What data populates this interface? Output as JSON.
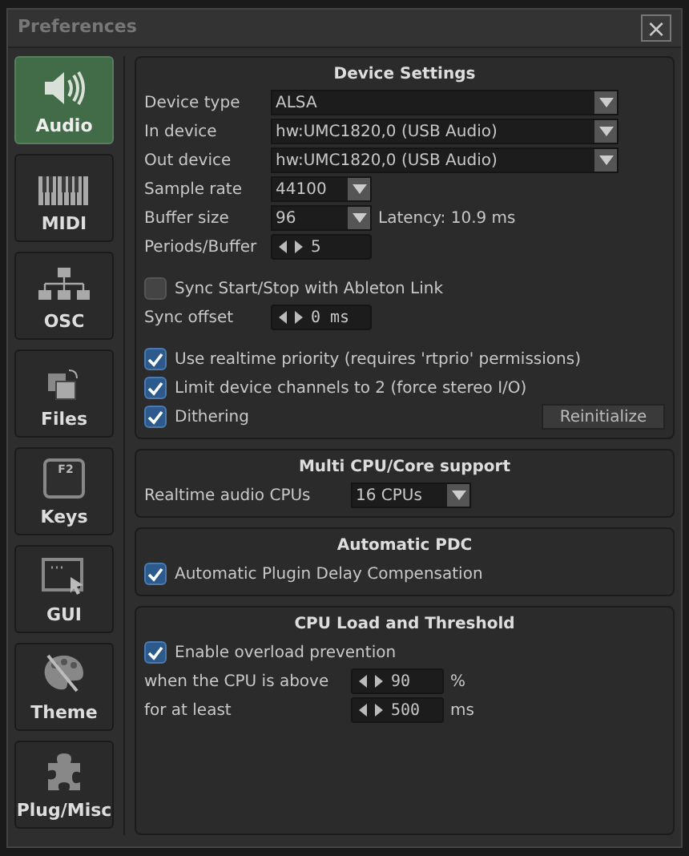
{
  "window": {
    "title": "Preferences",
    "close": "×"
  },
  "sidebar": {
    "items": [
      {
        "label": "Audio",
        "selected": true
      },
      {
        "label": "MIDI",
        "selected": false
      },
      {
        "label": "OSC",
        "selected": false
      },
      {
        "label": "Files",
        "selected": false
      },
      {
        "label": "Keys",
        "key_cap": "F2",
        "selected": false
      },
      {
        "label": "GUI",
        "selected": false
      },
      {
        "label": "Theme",
        "selected": false
      },
      {
        "label": "Plug/Misc",
        "selected": false
      }
    ]
  },
  "sections": [
    {
      "title": "Device Settings",
      "rows": [
        {
          "kind": "wide_select",
          "label": "Device type",
          "value": "ALSA"
        },
        {
          "kind": "wide_select",
          "label": "In device",
          "value": "hw:UMC1820,0 (USB Audio)"
        },
        {
          "kind": "wide_select",
          "label": "Out device",
          "value": "hw:UMC1820,0 (USB Audio)"
        },
        {
          "kind": "select",
          "label": "Sample rate",
          "value": "44100"
        },
        {
          "kind": "select",
          "label": "Buffer size",
          "value": "96",
          "note": "Latency: 10.9 ms"
        },
        {
          "kind": "spinner",
          "label": "Periods/Buffer",
          "value": "5"
        },
        {
          "kind": "gap"
        },
        {
          "kind": "checkbox",
          "label": "Sync Start/Stop with Ableton Link",
          "checked": false
        },
        {
          "kind": "spinner",
          "label": "Sync offset",
          "value": "0 ms"
        },
        {
          "kind": "gap"
        },
        {
          "kind": "checkbox",
          "label": "Use realtime priority (requires 'rtprio' permissions)",
          "checked": true
        },
        {
          "kind": "checkbox",
          "label": "Limit device channels to 2 (force stereo I/O)",
          "checked": true
        },
        {
          "kind": "checkbox",
          "label": "Dithering",
          "checked": true,
          "button": "Reinitialize"
        }
      ]
    },
    {
      "title": "Multi CPU/Core support",
      "rows": [
        {
          "kind": "cpu_select",
          "label": "Realtime audio CPUs",
          "value": "16 CPUs"
        }
      ]
    },
    {
      "title": "Automatic PDC",
      "rows": [
        {
          "kind": "checkbox",
          "label": "Automatic Plugin Delay Compensation",
          "checked": true
        }
      ]
    },
    {
      "title": "CPU Load and Threshold",
      "rows": [
        {
          "kind": "checkbox",
          "label": "Enable overload prevention",
          "checked": true
        },
        {
          "kind": "wide_spinner",
          "label": "when the CPU is above",
          "value": "90",
          "unit": "%"
        },
        {
          "kind": "wide_spinner",
          "label": "for at least",
          "value": "500",
          "unit": "ms"
        }
      ]
    }
  ]
}
